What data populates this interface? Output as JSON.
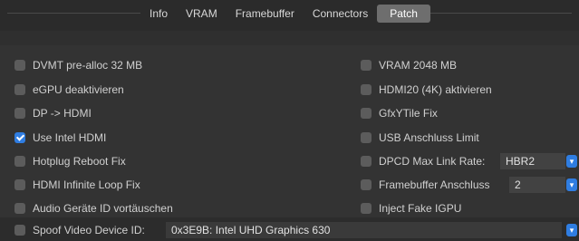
{
  "tabs": [
    {
      "label": "Info"
    },
    {
      "label": "VRAM"
    },
    {
      "label": "Framebuffer"
    },
    {
      "label": "Connectors"
    },
    {
      "label": "Patch"
    }
  ],
  "left": [
    {
      "label": "DVMT pre-alloc 32 MB",
      "checked": false
    },
    {
      "label": "eGPU deaktivieren",
      "checked": false
    },
    {
      "label": "DP -> HDMI",
      "checked": false
    },
    {
      "label": "Use Intel HDMI",
      "checked": true
    },
    {
      "label": "Hotplug Reboot Fix",
      "checked": false
    },
    {
      "label": "HDMI Infinite Loop Fix",
      "checked": false
    },
    {
      "label": "Audio Geräte ID vortäuschen",
      "checked": false
    }
  ],
  "right": [
    {
      "label": "VRAM 2048 MB",
      "checked": false
    },
    {
      "label": "HDMI20 (4K) aktivieren",
      "checked": false
    },
    {
      "label": "GfxYTile Fix",
      "checked": false
    },
    {
      "label": "USB Anschluss Limit",
      "checked": false
    },
    {
      "label": "DPCD Max Link Rate:",
      "checked": false,
      "select": "HBR2"
    },
    {
      "label": "Framebuffer Anschluss",
      "checked": false,
      "select": "2"
    },
    {
      "label": "Inject Fake IGPU",
      "checked": false
    }
  ],
  "spoof": {
    "label": "Spoof Video Device ID:",
    "value": "0x3E9B: Intel UHD Graphics 630",
    "checked": false
  },
  "colors": {
    "accent": "#2f7de1",
    "active_tab": "#6e6e6e"
  }
}
